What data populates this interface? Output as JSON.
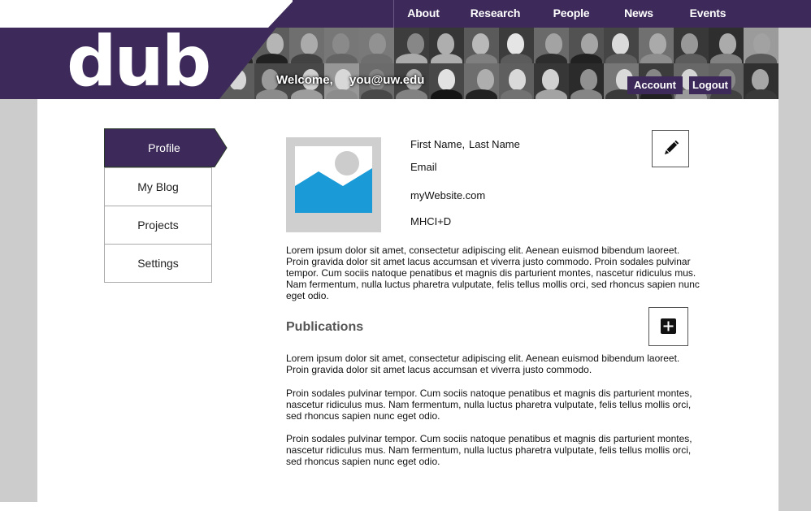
{
  "topnav": {
    "items": [
      "About",
      "Research",
      "People",
      "News",
      "Events"
    ]
  },
  "header": {
    "logo_text": "dub",
    "welcome_label": "Welcome,",
    "user_email": "you@uw.edu",
    "account_label": "Account",
    "logout_label": "Logout"
  },
  "sidebar": {
    "items": [
      {
        "label": "Profile",
        "active": true
      },
      {
        "label": "My Blog",
        "active": false
      },
      {
        "label": "Projects",
        "active": false
      },
      {
        "label": "Settings",
        "active": false
      }
    ]
  },
  "profile": {
    "first_name": "First Name,",
    "last_name": "Last Name",
    "email": "Email",
    "website": "myWebsite.com",
    "program": "MHCI+D",
    "edit_icon": "pencil-icon",
    "avatar_icon": "image-placeholder-icon",
    "bio": "Lorem ipsum dolor sit amet, consectetur adipiscing elit. Aenean euismod bibendum laoreet. Proin gravida dolor sit amet lacus accumsan et viverra justo commodo. Proin sodales pulvinar tempor. Cum sociis natoque penatibus et magnis dis parturient montes, nascetur ridiculus mus. Nam fermentum, nulla luctus pharetra vulputate, felis tellus mollis orci, sed rhoncus sapien nunc eget odio."
  },
  "publications": {
    "heading": "Publications",
    "add_icon": "plus-icon",
    "paragraphs": [
      "Lorem ipsum dolor sit amet, consectetur adipiscing elit. Aenean euismod bibendum laoreet. Proin gravida dolor sit amet lacus accumsan et viverra justo commodo.",
      "Proin sodales pulvinar tempor. Cum sociis natoque penatibus et magnis dis parturient montes, nascetur ridiculus mus. Nam fermentum, nulla luctus pharetra vulputate, felis tellus mollis orci, sed rhoncus sapien nunc eget odio.",
      "Proin sodales pulvinar tempor. Cum sociis natoque penatibus et magnis dis parturient montes, nascetur ridiculus mus. Nam fermentum, nulla luctus pharetra vulputate, felis tellus mollis orci, sed rhoncus sapien nunc eget odio."
    ]
  },
  "colors": {
    "brand_purple": "#3d2a5a",
    "gutter_gray": "#cccccc",
    "avatar_sky": "#1a9ad6"
  }
}
